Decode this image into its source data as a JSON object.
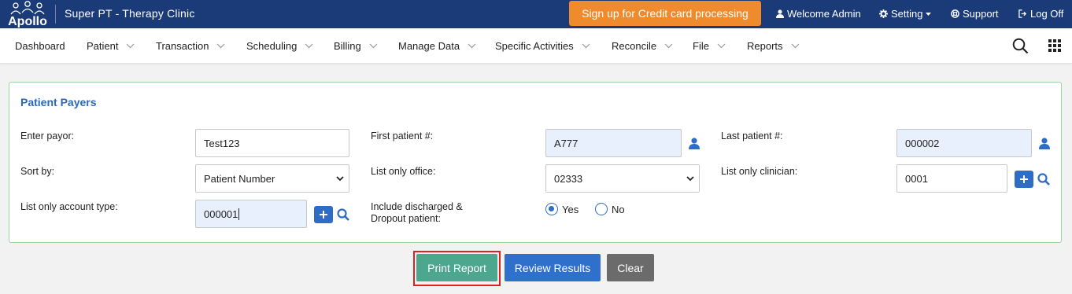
{
  "topbar": {
    "logo_text": "Apollo",
    "app_title": "Super PT - Therapy Clinic",
    "promo_label": "Sign up for Credit card processing",
    "welcome_label": "Welcome Admin",
    "setting_label": "Setting",
    "support_label": "Support",
    "logoff_label": "Log Off",
    "brand_color": "#1a3a78",
    "promo_color": "#ef8b2c"
  },
  "nav": {
    "items": [
      {
        "label": "Dashboard"
      },
      {
        "label": "Patient"
      },
      {
        "label": "Transaction"
      },
      {
        "label": "Scheduling"
      },
      {
        "label": "Billing"
      },
      {
        "label": "Manage Data"
      },
      {
        "label": "Specific Activities"
      },
      {
        "label": "Reconcile"
      },
      {
        "label": "File"
      },
      {
        "label": "Reports"
      }
    ],
    "search_icon": "search-icon",
    "apps_icon": "grid-icon"
  },
  "form": {
    "title": "Patient Payers",
    "enter_payor_label": "Enter payor:",
    "enter_payor_value": "Test123",
    "first_patient_label": "First patient #:",
    "first_patient_value": "A777",
    "last_patient_label": "Last patient #:",
    "last_patient_value": "000002",
    "sort_by_label": "Sort by:",
    "sort_by_value": "Patient Number",
    "office_label": "List only office:",
    "office_value": "02333",
    "clinician_label": "List only clinician:",
    "clinician_value": "0001",
    "account_type_label": "List only account type:",
    "account_type_value": "000001",
    "discharged_label_line1": "Include discharged &",
    "discharged_label_line2": "Dropout patient:",
    "yes_label": "Yes",
    "no_label": "No",
    "discharged_selected": "Yes",
    "accent_color": "#2e6cc5"
  },
  "actions": {
    "print_label": "Print Report",
    "review_label": "Review Results",
    "clear_label": "Clear"
  }
}
